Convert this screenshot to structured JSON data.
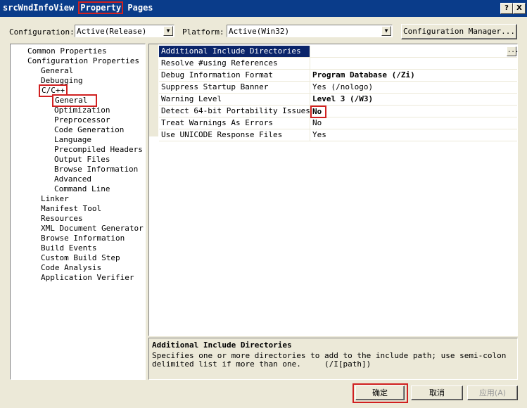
{
  "window": {
    "title_prefix": "srcWndInfoView ",
    "title_highlight": "Property",
    "title_suffix": " Pages",
    "help_btn": "?",
    "close_btn": "X"
  },
  "toolbar": {
    "configuration_label": "Configuration:",
    "configuration_value": "Active(Release)",
    "platform_label": "Platform:",
    "platform_value": "Active(Win32)",
    "config_manager_btn": "Configuration Manager..."
  },
  "tree": {
    "items": [
      "Common Properties",
      "Configuration Properties",
      "General",
      "Debugging",
      "C/C++",
      "General",
      "Optimization",
      "Preprocessor",
      "Code Generation",
      "Language",
      "Precompiled Headers",
      "Output Files",
      "Browse Information",
      "Advanced",
      "Command Line",
      "Linker",
      "Manifest Tool",
      "Resources",
      "XML Document Generator",
      "Browse Information",
      "Build Events",
      "Custom Build Step",
      "Code Analysis",
      "Application Verifier"
    ]
  },
  "grid": {
    "rows": [
      {
        "name": "Additional Include Directories",
        "value": ""
      },
      {
        "name": "Resolve #using References",
        "value": ""
      },
      {
        "name": "Debug Information Format",
        "value": "Program Database (/Zi)"
      },
      {
        "name": "Suppress Startup Banner",
        "value": "Yes (/nologo)"
      },
      {
        "name": "Warning Level",
        "value": "Level 3 (/W3)"
      },
      {
        "name": "Detect 64-bit Portability Issues",
        "value": "No"
      },
      {
        "name": "Treat Warnings As Errors",
        "value": "No"
      },
      {
        "name": "Use UNICODE Response Files",
        "value": "Yes"
      }
    ],
    "ellipsis": "..."
  },
  "description": {
    "title": "Additional Include Directories",
    "text": "Specifies one or more directories to add to the include path; use semi-colon\ndelimited list if more than one.     (/I[path])"
  },
  "buttons": {
    "ok": "确定",
    "cancel": "取消",
    "apply": "应用(A)"
  }
}
